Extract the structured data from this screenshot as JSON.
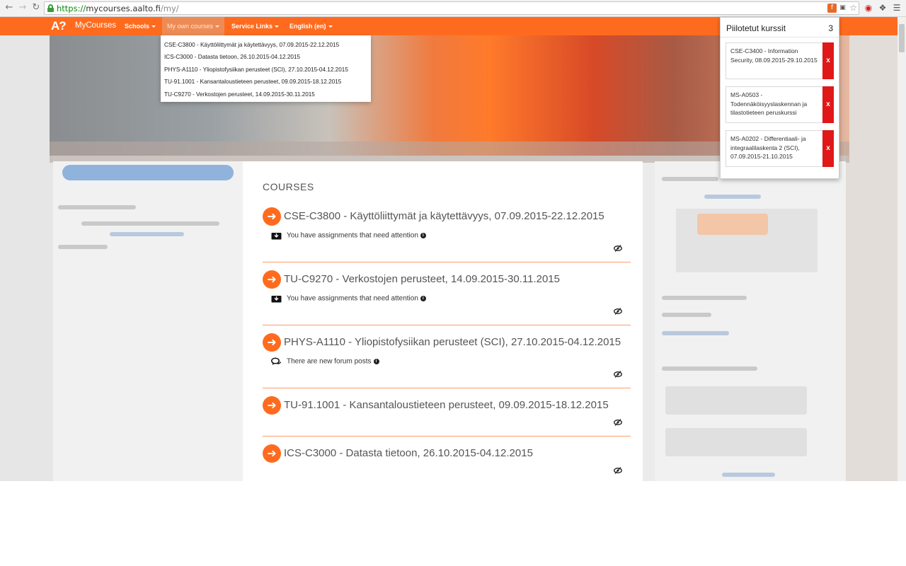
{
  "browser": {
    "url_scheme": "https://",
    "url_host": "mycourses.aalto.fi",
    "url_path": "/my/",
    "icons": [
      "back-icon",
      "forward-icon",
      "reload-icon",
      "lock-icon",
      "flash-icon",
      "translate-icon",
      "star-icon",
      "opera-icon",
      "extension-icon",
      "menu-icon"
    ]
  },
  "navbar": {
    "logo": "A?",
    "brand": "MyCourses",
    "items": [
      {
        "label": "Schools"
      },
      {
        "label": "My own courses"
      },
      {
        "label": "Service Links"
      },
      {
        "label": "English (en)"
      }
    ],
    "color": "#ff6b1e"
  },
  "dropdown": {
    "items": [
      "CSE-C3800 - Käyttöliittymät ja käytettävyys, 07.09.2015-22.12.2015",
      "ICS-C3000 - Datasta tietoon, 26.10.2015-04.12.2015",
      "PHYS-A1110 - Yliopistofysiikan perusteet (SCI), 27.10.2015-04.12.2015",
      "TU-91.1001 - Kansantaloustieteen perusteet, 09.09.2015-18.12.2015",
      "TU-C9270 - Verkostojen perusteet, 14.09.2015-30.11.2015"
    ]
  },
  "main": {
    "heading": "COURSES",
    "courses": [
      {
        "title": "CSE-C3800 - Käyttöliittymät ja käytettävyys, 07.09.2015-22.12.2015",
        "notice": "You have assignments that need attention"
      },
      {
        "title": "TU-C9270 - Verkostojen perusteet, 14.09.2015-30.11.2015",
        "notice": "You have assignments that need attention"
      },
      {
        "title": "PHYS-A1110 - Yliopistofysiikan perusteet (SCI), 27.10.2015-04.12.2015",
        "notice": "There are new forum posts"
      },
      {
        "title": "TU-91.1001 - Kansantaloustieteen perusteet, 09.09.2015-18.12.2015",
        "notice": ""
      },
      {
        "title": "ICS-C3000 - Datasta tietoon, 26.10.2015-04.12.2015",
        "notice": ""
      }
    ]
  },
  "popup": {
    "title": "Piilotetut kurssit",
    "count": "3",
    "items": [
      {
        "text": "CSE-C3400 - Information Security, 08.09.2015-29.10.2015",
        "button": "x"
      },
      {
        "text": "MS-A0503 - Todennäköisyyslaskennan ja tilastotieteen peruskurssi",
        "button": "x"
      },
      {
        "text": "MS-A0202 - Differentiaali- ja integraalilaskenta 2 (SCI), 07.09.2015-21.10.2015",
        "button": "x"
      }
    ]
  },
  "colors": {
    "accent": "#ff6b1e",
    "remove": "#e01818",
    "divider": "#ff9a6a"
  }
}
